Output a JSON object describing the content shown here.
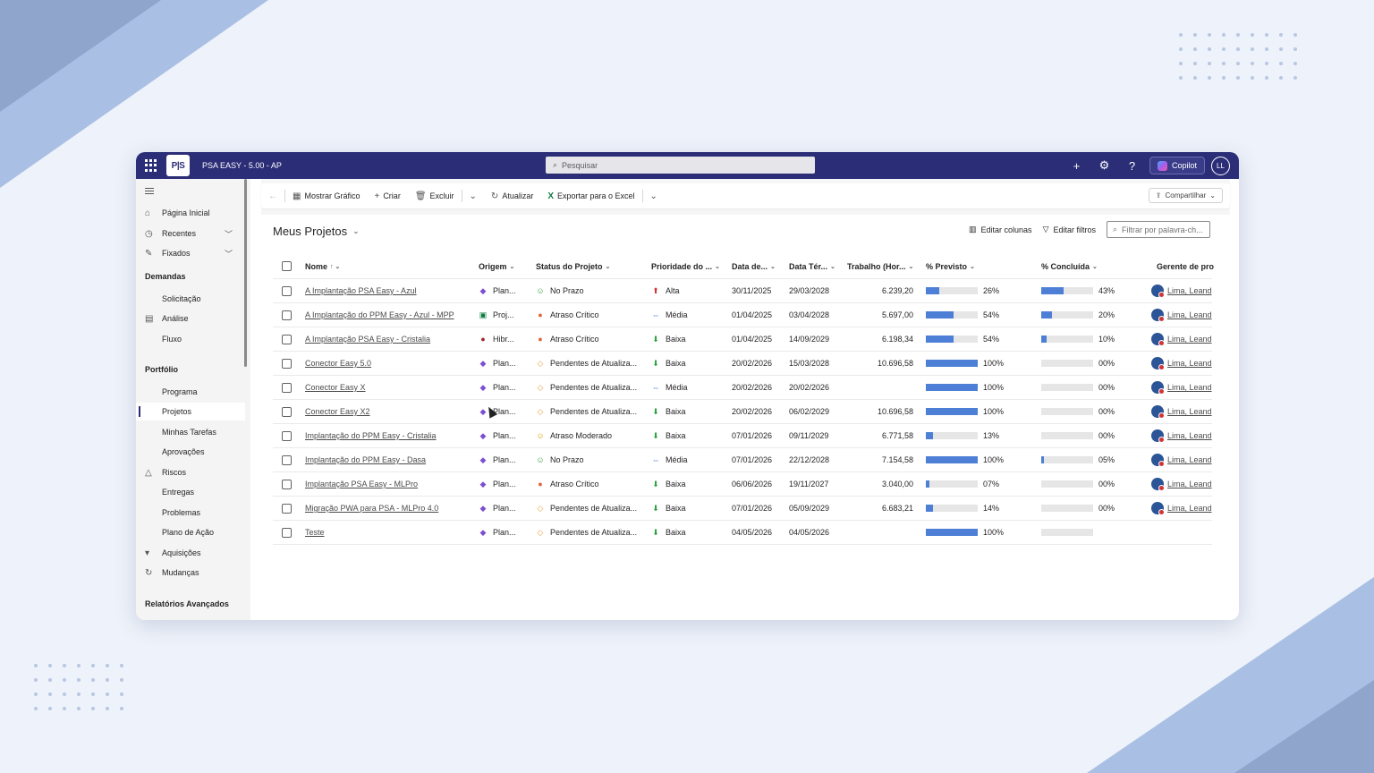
{
  "app": {
    "title": "PSA EASY - 5.00 - AP",
    "logo_text": "P|S",
    "search_placeholder": "Pesquisar",
    "copilot_label": "Copilot",
    "user_initials": "LL"
  },
  "sidebar": {
    "items": [
      {
        "label": "Página Inicial",
        "icon": "home-icon"
      },
      {
        "label": "Recentes",
        "icon": "clock-icon"
      },
      {
        "label": "Fixados",
        "icon": "pin-icon"
      }
    ],
    "group_demandas": "Demandas",
    "demandas": [
      "Solicitação",
      "Análise",
      "Fluxo"
    ],
    "group_portfolio": "Portfólio",
    "portfolio": [
      "Programa",
      "Projetos",
      "Minhas Tarefas",
      "Aprovações",
      "Riscos",
      "Entregas",
      "Problemas",
      "Plano de Ação",
      "Aquisições",
      "Mudanças"
    ],
    "group_relatorios": "Relatórios Avançados",
    "active_item": "Projetos"
  },
  "commandbar": {
    "mostrar_grafico": "Mostrar Gráfico",
    "criar": "Criar",
    "excluir": "Excluir",
    "atualizar": "Atualizar",
    "exportar_excel": "Exportar para o Excel",
    "compartilhar": "Compartilhar"
  },
  "view": {
    "title": "Meus Projetos",
    "editar_colunas": "Editar colunas",
    "editar_filtros": "Editar filtros",
    "filter_placeholder": "Filtrar por palavra-ch..."
  },
  "table": {
    "columns": [
      "Nome",
      "Origem",
      "Status do Projeto",
      "Prioridade do ...",
      "Data de...",
      "Data Tér...",
      "Trabalho (Hor...",
      "% Previsto",
      "% Concluída",
      "Gerente de pro"
    ],
    "rows": [
      {
        "nome": " A Implantação PSA Easy - Azul",
        "origem": "Plan...",
        "origem_icon": "planner-icon",
        "status": "No Prazo",
        "status_icon": "green-smiley",
        "prioridade": "Alta",
        "prio_icon": "arrow-up-red",
        "inicio": "30/11/2025",
        "termino": "29/03/2028",
        "trabalho": "6.239,20",
        "previsto": 26,
        "previsto_label": "26%",
        "concluida": 43,
        "concluida_label": "43%",
        "gerente": "Lima, Leand"
      },
      {
        "nome": "A Implantação do PPM Easy - Azul - MPP",
        "origem": "Proj...",
        "origem_icon": "project-icon",
        "status": "Atraso Crítico",
        "status_icon": "red-face",
        "prioridade": "Média",
        "prio_icon": "arrow-both-blue",
        "inicio": "01/04/2025",
        "termino": "03/04/2028",
        "trabalho": "5.697,00",
        "previsto": 54,
        "previsto_label": "54%",
        "concluida": 20,
        "concluida_label": "20%",
        "gerente": "Lima, Leand"
      },
      {
        "nome": "A Implantação PSA Easy - Cristalia",
        "origem": "Hibr...",
        "origem_icon": "hybrid-icon",
        "status": "Atraso Crítico",
        "status_icon": "red-face",
        "prioridade": "Baixa",
        "prio_icon": "arrow-down-green",
        "inicio": "01/04/2025",
        "termino": "14/09/2029",
        "trabalho": "6.198,34",
        "previsto": 54,
        "previsto_label": "54%",
        "concluida": 10,
        "concluida_label": "10%",
        "gerente": "Lima, Leand"
      },
      {
        "nome": "Conector Easy 5.0",
        "origem": "Plan...",
        "origem_icon": "planner-icon",
        "status": "Pendentes de Atualiza...",
        "status_icon": "orange-diamond",
        "prioridade": "Baixa",
        "prio_icon": "arrow-down-green",
        "inicio": "20/02/2026",
        "termino": "15/03/2028",
        "trabalho": "10.696,58",
        "previsto": 100,
        "previsto_label": "100%",
        "concluida": 0,
        "concluida_label": "00%",
        "gerente": "Lima, Leand"
      },
      {
        "nome": "Conector Easy X",
        "origem": "Plan...",
        "origem_icon": "planner-icon",
        "status": "Pendentes de Atualiza...",
        "status_icon": "orange-diamond",
        "prioridade": "Média",
        "prio_icon": "arrow-both-blue",
        "inicio": "20/02/2026",
        "termino": "20/02/2026",
        "trabalho": "",
        "previsto": 100,
        "previsto_label": "100%",
        "concluida": 0,
        "concluida_label": "00%",
        "gerente": "Lima, Leand"
      },
      {
        "nome": "Conector Easy X2",
        "origem": "Plan...",
        "origem_icon": "planner-icon",
        "status": "Pendentes de Atualiza...",
        "status_icon": "orange-diamond",
        "prioridade": "Baixa",
        "prio_icon": "arrow-down-green",
        "inicio": "20/02/2026",
        "termino": "06/02/2029",
        "trabalho": "10.696,58",
        "previsto": 100,
        "previsto_label": "100%",
        "concluida": 0,
        "concluida_label": "00%",
        "gerente": "Lima, Leand"
      },
      {
        "nome": "Implantação do PPM Easy  - Cristalia",
        "origem": "Plan...",
        "origem_icon": "planner-icon",
        "status": "Atraso Moderado",
        "status_icon": "yellow-face",
        "prioridade": "Baixa",
        "prio_icon": "arrow-down-green",
        "inicio": "07/01/2026",
        "termino": "09/11/2029",
        "trabalho": "6.771,58",
        "previsto": 13,
        "previsto_label": "13%",
        "concluida": 0,
        "concluida_label": "00%",
        "gerente": "Lima, Leand"
      },
      {
        "nome": "Implantação do PPM Easy - Dasa",
        "origem": "Plan...",
        "origem_icon": "planner-icon",
        "status": "No Prazo",
        "status_icon": "green-smiley",
        "prioridade": "Média",
        "prio_icon": "arrow-both-blue",
        "inicio": "07/01/2026",
        "termino": "22/12/2028",
        "trabalho": "7.154,58",
        "previsto": 100,
        "previsto_label": "100%",
        "concluida": 5,
        "concluida_label": "05%",
        "gerente": "Lima, Leand"
      },
      {
        "nome": "Implantação PSA Easy - MLPro",
        "origem": "Plan...",
        "origem_icon": "planner-icon",
        "status": "Atraso Crítico",
        "status_icon": "red-face",
        "prioridade": "Baixa",
        "prio_icon": "arrow-down-green",
        "inicio": "06/06/2026",
        "termino": "19/11/2027",
        "trabalho": "3.040,00",
        "previsto": 7,
        "previsto_label": "07%",
        "concluida": 0,
        "concluida_label": "00%",
        "gerente": "Lima, Leand"
      },
      {
        "nome": "Migração PWA para PSA - MLPro 4.0",
        "origem": "Plan...",
        "origem_icon": "planner-icon",
        "status": "Pendentes de Atualiza...",
        "status_icon": "orange-diamond",
        "prioridade": "Baixa",
        "prio_icon": "arrow-down-green",
        "inicio": "07/01/2026",
        "termino": "05/09/2029",
        "trabalho": "6.683,21",
        "previsto": 14,
        "previsto_label": "14%",
        "concluida": 0,
        "concluida_label": "00%",
        "gerente": "Lima, Leand"
      },
      {
        "nome": "Teste",
        "origem": "Plan...",
        "origem_icon": "planner-icon",
        "status": "Pendentes de Atualiza...",
        "status_icon": "orange-diamond",
        "prioridade": "Baixa",
        "prio_icon": "arrow-down-green",
        "inicio": "04/05/2026",
        "termino": "04/05/2026",
        "trabalho": "",
        "previsto": 100,
        "previsto_label": "100%",
        "concluida": 0,
        "concluida_label": "",
        "gerente": ""
      }
    ]
  },
  "colors": {
    "topbar": "#2b2d77",
    "bar_fill": "#4d7fd6",
    "bar_track": "#e6e6e6"
  }
}
